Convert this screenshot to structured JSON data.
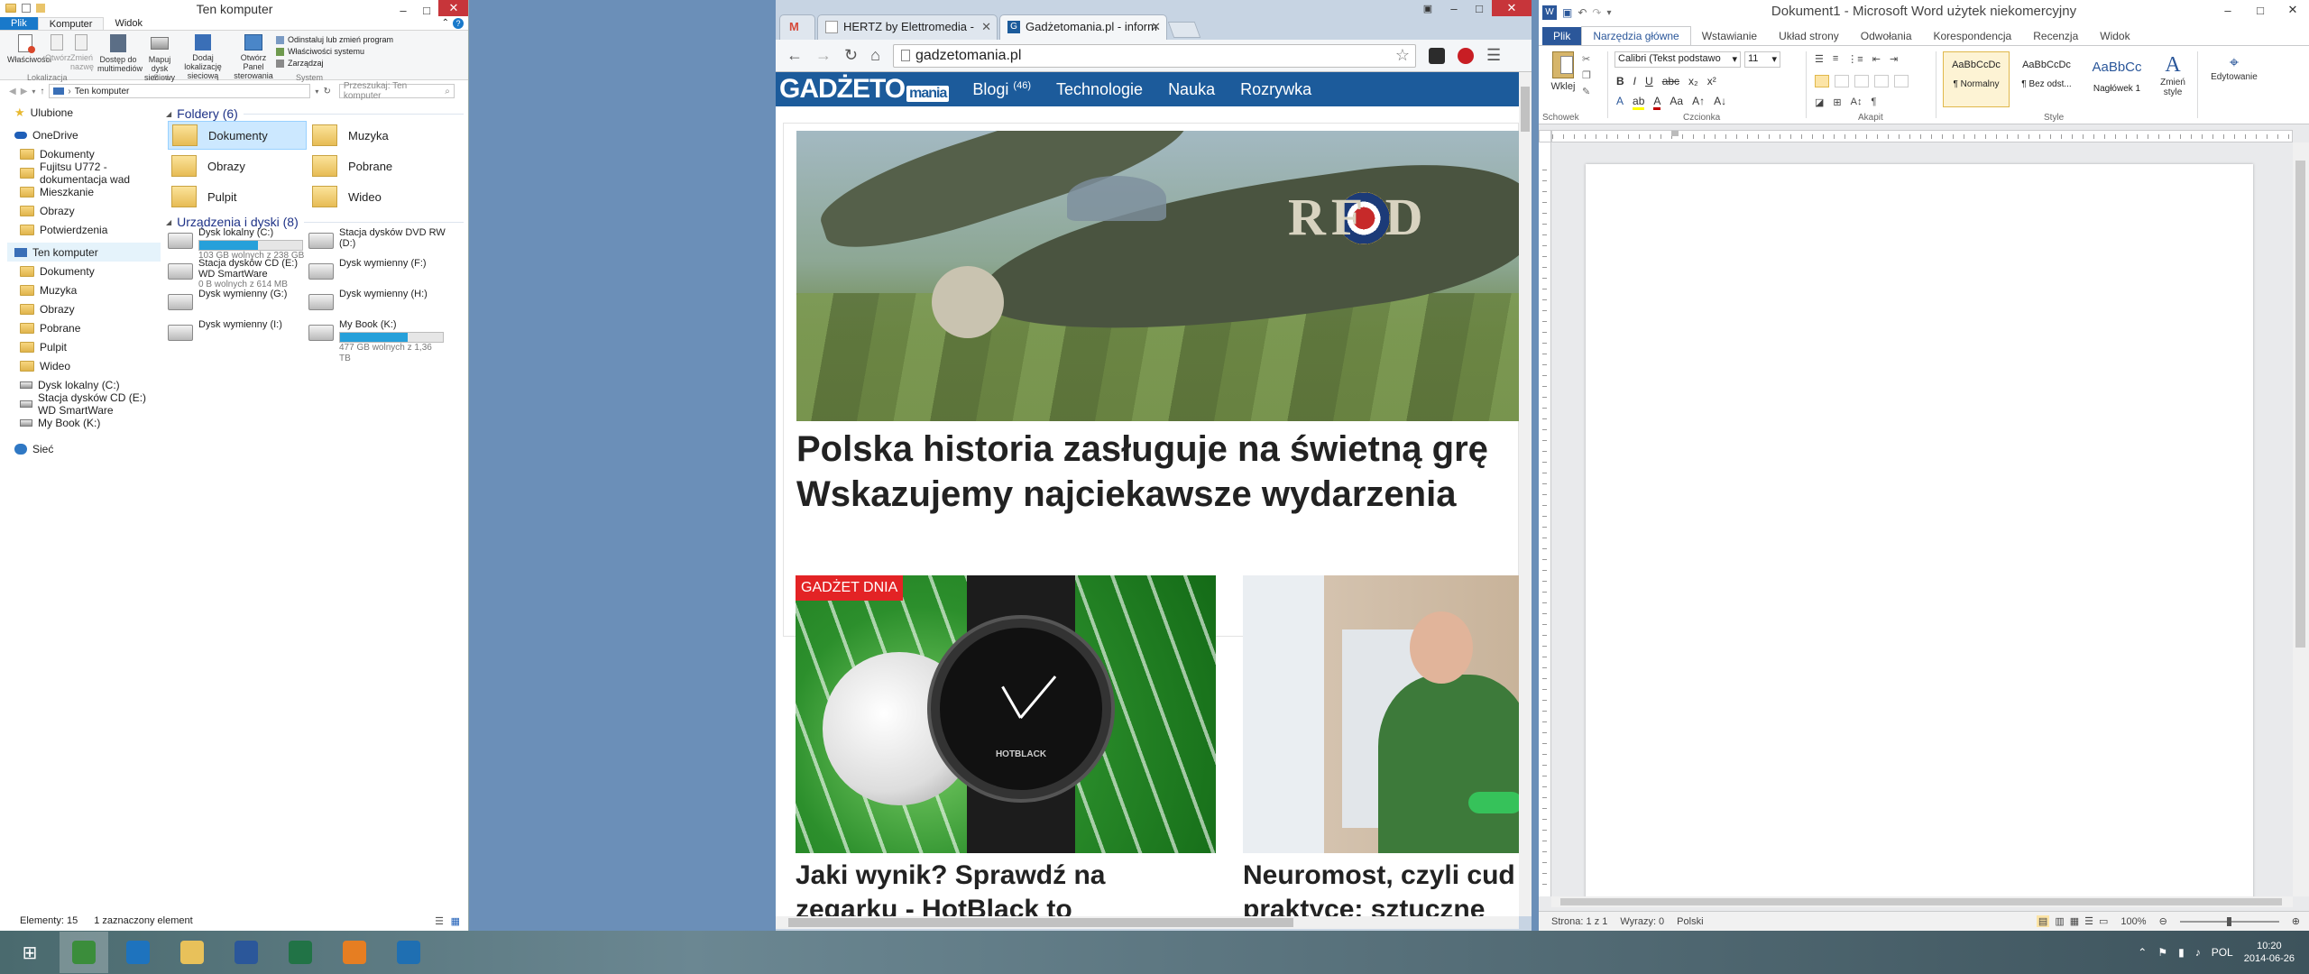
{
  "explorer": {
    "title": "Ten komputer",
    "tabs": [
      "Plik",
      "Komputer",
      "Widok"
    ],
    "ribbon": {
      "groups": [
        {
          "label": "Lokalizacja",
          "items": [
            "Właściwości",
            "Otwórz",
            "Zmień nazwę"
          ]
        },
        {
          "label": "Sieć",
          "items": [
            "Dostęp do multimediów",
            "Mapuj dysk sieciowy",
            "Dodaj lokalizację sieciową"
          ]
        },
        {
          "label": "System",
          "items": [
            "Otwórz Panel sterowania",
            "Odinstaluj lub zmień program",
            "Właściwości systemu",
            "Zarządzaj"
          ]
        }
      ]
    },
    "address": "Ten komputer",
    "search_placeholder": "Przeszukaj: Ten komputer",
    "nav": {
      "favorites": "Ulubione",
      "onedrive": "OneDrive",
      "onedrive_items": [
        "Dokumenty",
        "Fujitsu U772 - dokumentacja wad",
        "Mieszkanie",
        "Obrazy",
        "Potwierdzenia"
      ],
      "thispc": "Ten komputer",
      "thispc_items": [
        "Dokumenty",
        "Muzyka",
        "Obrazy",
        "Pobrane",
        "Pulpit",
        "Wideo",
        "Dysk lokalny (C:)",
        "Stacja dysków CD (E:) WD SmartWare",
        "My Book (K:)"
      ],
      "network": "Sieć"
    },
    "folders_header": "Foldery (6)",
    "folders": [
      "Dokumenty",
      "Muzyka",
      "Obrazy",
      "Pobrane",
      "Pulpit",
      "Wideo"
    ],
    "devices_header": "Urządzenia i dyski (8)",
    "devices": [
      {
        "name": "Dysk lokalny (C:)",
        "info": "103 GB wolnych z 238 GB",
        "used": 0.57
      },
      {
        "name": "Stacja dysków DVD RW (D:)",
        "info": "",
        "used": null
      },
      {
        "name": "Stacja dysków CD (E:) WD SmartWare",
        "info": "0 B wolnych z 614 MB",
        "used": null
      },
      {
        "name": "Dysk wymienny (F:)",
        "info": "",
        "used": null
      },
      {
        "name": "Dysk wymienny (G:)",
        "info": "",
        "used": null
      },
      {
        "name": "Dysk wymienny (H:)",
        "info": "",
        "used": null
      },
      {
        "name": "Dysk wymienny (I:)",
        "info": "",
        "used": null
      },
      {
        "name": "My Book (K:)",
        "info": "477 GB wolnych z 1,36 TB",
        "used": 0.66
      }
    ],
    "status": {
      "count": "Elementy: 15",
      "selected": "1 zaznaczony element"
    }
  },
  "browser": {
    "tabs": [
      {
        "title": "M",
        "active": false
      },
      {
        "title": "HERTZ by Elettromedia - ",
        "active": false
      },
      {
        "title": "Gadżetomania.pl - inform",
        "active": true
      }
    ],
    "url": "gadzetomania.pl",
    "site": {
      "logo": "GADŻETO",
      "logo_suffix": "mania",
      "nav": [
        "Blogi",
        "Technologie",
        "Nauka",
        "Rozrywka"
      ],
      "blogi_count": "(46)",
      "headline_line1": "Polska historia zasługuje na świetną grę",
      "headline_line2": "Wskazujemy najciekawsze wydarzenia",
      "badge": "GADŻET DNIA",
      "card1_title_line1": "Jaki wynik? Sprawdź na",
      "card1_title_line2": "zegarku - HotBlack to",
      "card2_title_line1": "Neuromost, czyli cud",
      "card2_title_line2": "praktyce: sztuczne",
      "watch_brand": "HOTBLACK",
      "plane_letters": "RF D"
    },
    "colors": {
      "nav_bg": "#1c5b9b",
      "badge": "#e32325"
    }
  },
  "word": {
    "title": "Dokument1 - Microsoft Word użytek niekomercyjny",
    "tabs": [
      "Plik",
      "Narzędzia główne",
      "Wstawianie",
      "Układ strony",
      "Odwołania",
      "Korespondencja",
      "Recenzja",
      "Widok"
    ],
    "paste": "Wklej",
    "font": "Calibri (Tekst podstawo",
    "size": "11",
    "styles": [
      {
        "preview": "AaBbCcDc",
        "name": "¶ Normalny"
      },
      {
        "preview": "AaBbCcDc",
        "name": "¶ Bez odst..."
      },
      {
        "preview": "AaBbCc",
        "name": "Nagłówek 1"
      }
    ],
    "change_styles": "Zmień style",
    "editing": "Edytowanie",
    "groups": [
      "Schowek",
      "Czcionka",
      "Akapit",
      "Style"
    ],
    "status": {
      "page": "Strona: 1 z 1",
      "words": "Wyrazy: 0",
      "lang": "Polski",
      "zoom": "100%"
    }
  },
  "taskbar": {
    "apps": [
      "start-icon",
      "chrome-icon",
      "ie-icon",
      "explorer-icon",
      "word-icon",
      "excel-icon",
      "media-icon",
      "mail-icon"
    ],
    "lang": "POL",
    "time": "10:20",
    "date": "2014-06-26"
  }
}
